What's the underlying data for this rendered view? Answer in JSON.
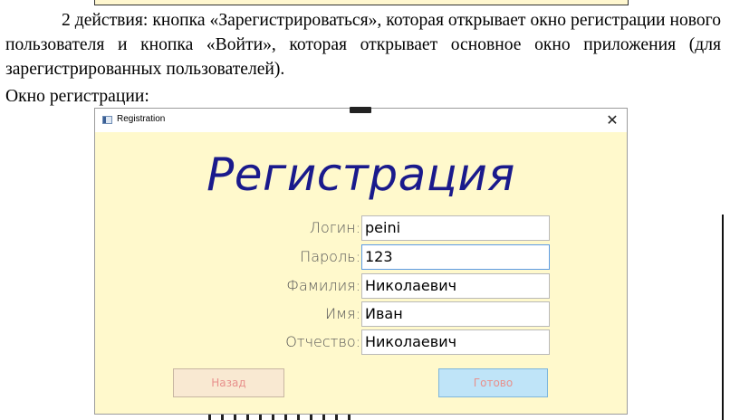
{
  "document": {
    "paragraph": "2 действия: кнопка «Зарегистрироваться», которая открывает окно регистрации нового пользователя и кнопка «Войти», которая открывает основное окно приложения (для зарегистрированных пользователей).",
    "caption": "Окно регистрации:"
  },
  "window": {
    "title": "Registration",
    "close_glyph": "✕",
    "heading": "Регистрация",
    "fields": [
      {
        "label": "Логин:",
        "value": "peini"
      },
      {
        "label": "Пароль:",
        "value": "123"
      },
      {
        "label": "Фамилия:",
        "value": "Николаевич"
      },
      {
        "label": "Имя:",
        "value": "Иван"
      },
      {
        "label": "Отчество:",
        "value": "Николаевич"
      }
    ],
    "buttons": {
      "back": "Назад",
      "done": "Готово"
    }
  },
  "colors": {
    "window_bg": "#fff9cc",
    "heading": "#1a1a8c",
    "back_button_bg": "#f9e9d2",
    "done_button_bg": "#bfe4f8",
    "button_text": "#e8908c",
    "active_border": "#5c9be6"
  },
  "icons": {
    "app": "window-app-icon",
    "close": "close-icon"
  }
}
